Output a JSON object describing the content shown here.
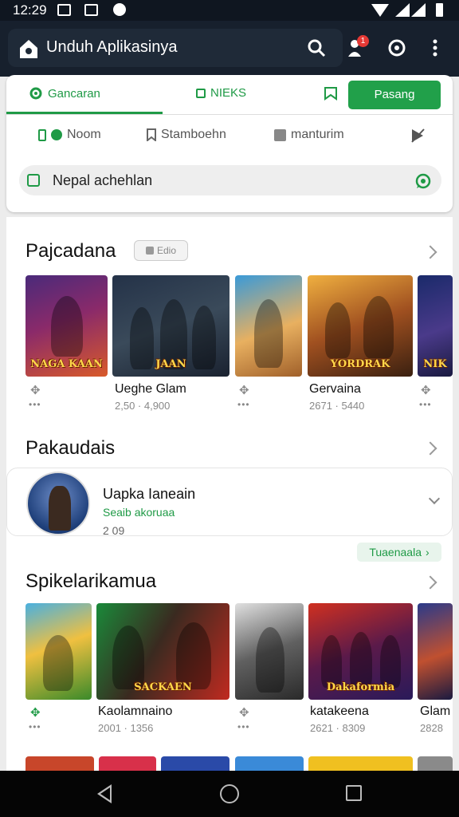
{
  "status_bar": {
    "time": "12:29"
  },
  "header": {
    "title": "Unduh Aplikasinya",
    "badge": "1"
  },
  "tabs": [
    {
      "label": "Gancaran"
    },
    {
      "label": "NIEKS"
    }
  ],
  "install_button": {
    "label": "Pasang sekarang"
  },
  "filters": [
    {
      "label": "Noom"
    },
    {
      "label": "Stamboehn"
    },
    {
      "label": "manturim"
    }
  ],
  "search": {
    "value": "Nepal achehlan"
  },
  "section1": {
    "title": "Pajcadana",
    "pill": "Edio",
    "items": [
      {
        "caption": "NAGA KAAN",
        "title": "",
        "sub": ""
      },
      {
        "caption": "JAAN",
        "title": "Ueghe Glam",
        "sub": "2,50 · 4,900"
      },
      {
        "caption": "",
        "title": "",
        "sub": ""
      },
      {
        "caption": "YORDRAK",
        "title": "Gervaina",
        "sub": "2671 · 5440"
      },
      {
        "caption": "NIK",
        "title": "",
        "sub": ""
      }
    ]
  },
  "section2": {
    "title": "Pakaudais",
    "app": {
      "name": "Uapka Ianeain",
      "sub": "Seaib akoruaa",
      "size": "2 09"
    },
    "more_label": "Tuaenaala"
  },
  "section3": {
    "title": "Spikelarikamua",
    "items": [
      {
        "caption": "",
        "title": "",
        "sub": ""
      },
      {
        "caption": "SACKAEN",
        "title": "Kaolamnaino",
        "sub": "2001 · 1356"
      },
      {
        "caption": "",
        "title": "",
        "sub": ""
      },
      {
        "caption": "Dakaformia",
        "title": "katakeena",
        "sub": "2621 · 8309"
      },
      {
        "caption": "",
        "title": "Glam",
        "sub": "2828"
      }
    ]
  },
  "colors": {
    "accent": "#1f9a46",
    "header_bg": "#17202d",
    "status_bg": "#0f1620"
  }
}
